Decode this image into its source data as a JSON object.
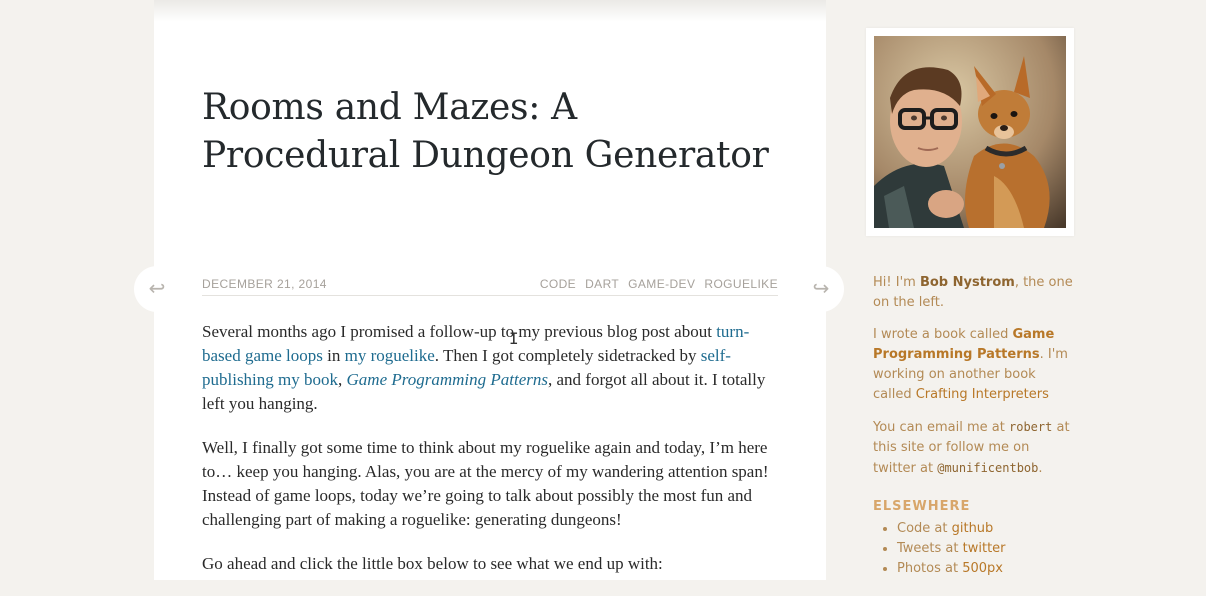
{
  "post": {
    "title": "Rooms and Mazes: A Procedural Dungeon Generator",
    "date": "DECEMBER 21, 2014",
    "tags": [
      "CODE",
      "DART",
      "GAME-DEV",
      "ROGUELIKE"
    ],
    "prev_arrow": "↩",
    "next_arrow": "↪"
  },
  "body": {
    "p1_a": "Several months ago I promised a follow-up to my previous blog post about ",
    "p1_link1": "turn-based game loops",
    "p1_b": " in ",
    "p1_link2": "my roguelike",
    "p1_c": ". Then I got completely sidetracked by ",
    "p1_link3": "self-publishing my book",
    "p1_d": ", ",
    "p1_link4": "Game Programming Patterns",
    "p1_e": ", and forgot all about it. I totally left you hanging.",
    "p2": "Well, I finally got some time to think about my roguelike again and today, I’m here to… keep you hanging. Alas, you are at the mercy of my wandering attention span! Instead of game loops, today we’re going to talk about possibly the most fun and challenging part of making a roguelike: generating dungeons!",
    "p3": "Go ahead and click the little box below to see what we end up with:"
  },
  "sidebar": {
    "intro_a": "Hi! I'm ",
    "intro_name": "Bob Nystrom",
    "intro_b": ", the one on the left.",
    "book_a": "I wrote a book called ",
    "book_link": "Game Programming Patterns",
    "book_b": ". I'm working on another book called ",
    "book_link2": "Crafting Interpreters",
    "email_a": "You can email me at ",
    "email_user": "robert",
    "email_b": " at this site or follow me on twitter at ",
    "twitter_handle": "@munificentbob",
    "email_c": ".",
    "elsewhere_title": "ELSEWHERE",
    "elsewhere": [
      {
        "prefix": "Code at ",
        "link": "github"
      },
      {
        "prefix": "Tweets at ",
        "link": "twitter"
      },
      {
        "prefix": "Photos at ",
        "link": "500px"
      }
    ]
  }
}
